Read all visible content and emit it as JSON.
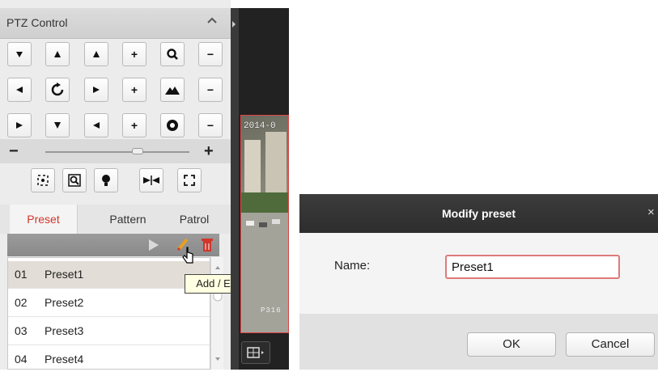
{
  "ptz": {
    "title": "PTZ Control",
    "collapse_icon": "chevron-up-icon",
    "rows": [
      [
        "▼",
        "▲",
        "◀",
        "+",
        "magnifier-icon",
        "−"
      ],
      [
        "◀",
        "rotate-icon",
        "▶",
        "+",
        "mountain-icon",
        "−"
      ],
      [
        "▶",
        "▼",
        "◀",
        "+",
        "iris-icon",
        "−"
      ]
    ],
    "slider": {
      "minus": "−",
      "plus": "+",
      "value": 0.64
    },
    "tools": [
      "focus-3d-icon",
      "zoom-area-icon",
      "light-icon",
      "wiper-icon",
      "fullscreen-icon"
    ],
    "tabs": {
      "preset": "Preset",
      "pattern": "Pattern",
      "patrol": "Patrol",
      "active": "preset"
    },
    "presets": [
      {
        "num": "01",
        "name": "Preset1",
        "selected": true
      },
      {
        "num": "02",
        "name": "Preset2"
      },
      {
        "num": "03",
        "name": "Preset3"
      },
      {
        "num": "04",
        "name": "Preset4"
      }
    ],
    "tooltip": "Add / Edit Preset"
  },
  "video": {
    "timestamp": "2014-0",
    "camera_label": "P316"
  },
  "dialog": {
    "title": "Modify preset",
    "close": "×",
    "name_label": "Name:",
    "name_value": "Preset1",
    "ok_label": "OK",
    "cancel_label": "Cancel"
  },
  "colors": {
    "accent_red": "#d2352b",
    "dialog_header": "#333333",
    "input_border": "#e07a7a"
  }
}
